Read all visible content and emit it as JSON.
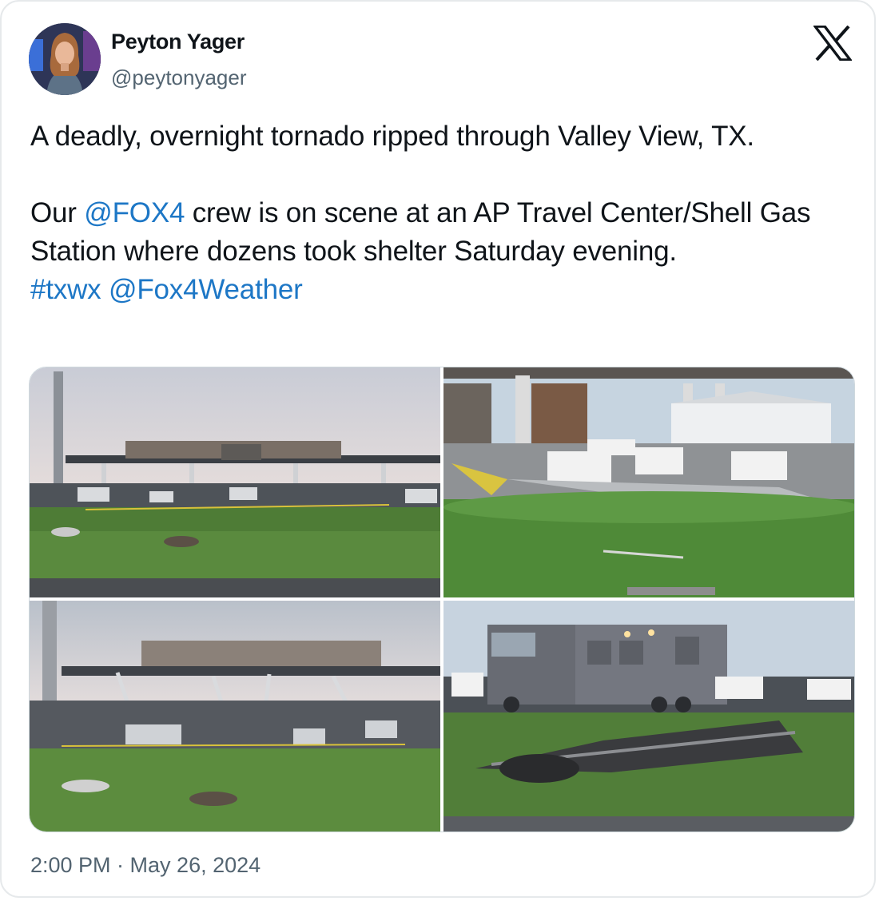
{
  "author": {
    "name": "Peyton Yager",
    "handle": "@peytonyager",
    "avatar_icon": "profile-photo"
  },
  "platform_icon": "x-logo-icon",
  "tweet": {
    "line1": "A deadly, overnight tornado ripped through Valley View, TX.",
    "p2_before": "Our ",
    "mention1": "@FOX4",
    "p2_after": " crew is on scene at an AP Travel Center/Shell Gas Station where dozens took shelter Saturday evening.",
    "hashtag": "#txwx",
    "mention2": "@Fox4Weather"
  },
  "media": {
    "photos": [
      {
        "description_icon": "tornado-damage-gas-station-photo"
      },
      {
        "description_icon": "damaged-vehicles-photo"
      },
      {
        "description_icon": "collapsed-canopy-photo"
      },
      {
        "description_icon": "rv-debris-photo"
      }
    ]
  },
  "timestamp": "2:00 PM · May 26, 2024",
  "colors": {
    "link": "#1d77c6",
    "text": "#0f1419",
    "secondary": "#536471"
  }
}
